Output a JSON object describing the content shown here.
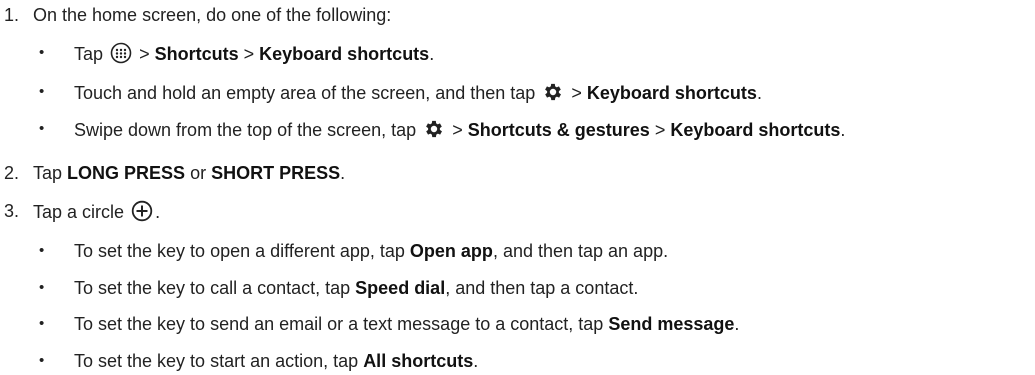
{
  "steps": [
    {
      "number": "1.",
      "text": "On the home screen, do one of the following:",
      "bullets": [
        {
          "t1": "Tap",
          "icon1": "apps-tray-icon",
          "t2": ">",
          "b1": "Shortcuts",
          "t3": ">",
          "b2": "Keyboard shortcuts",
          "t4": "."
        },
        {
          "t1": "Touch and hold an empty area of the screen, and then tap",
          "icon1": "gear-icon",
          "t2": ">",
          "b1": "Keyboard shortcuts",
          "t3": "."
        },
        {
          "t1": "Swipe down from the top of the screen, tap",
          "icon1": "gear-icon",
          "t2": ">",
          "b1": "Shortcuts & gestures",
          "t3": ">",
          "b2": "Keyboard shortcuts",
          "t4": "."
        }
      ]
    },
    {
      "number": "2.",
      "t1": "Tap",
      "b1": "LONG PRESS",
      "t2": "or",
      "b2": "SHORT PRESS",
      "t3": "."
    },
    {
      "number": "3.",
      "t1": "Tap a circle",
      "icon1": "add-circle-icon",
      "t2": ".",
      "bullets": [
        {
          "t1": "To set the key to open a different app, tap",
          "b1": "Open app",
          "t2": ", and then tap an app."
        },
        {
          "t1": "To set the key to call a contact, tap",
          "b1": "Speed dial",
          "t2": ", and then tap a contact."
        },
        {
          "t1": "To set the key to send an email or a text message to a contact, tap",
          "b1": "Send message",
          "t2": "."
        },
        {
          "t1": "To set the key to start an action, tap",
          "b1": "All shortcuts",
          "t2": "."
        }
      ]
    }
  ],
  "bullet_glyph": "•"
}
